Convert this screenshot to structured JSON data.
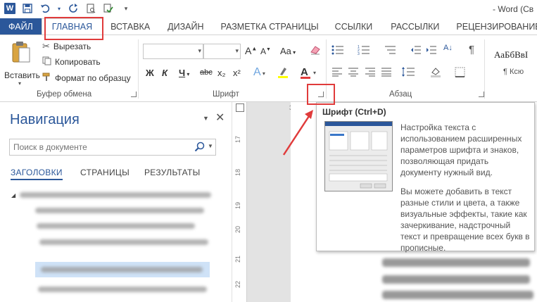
{
  "app": {
    "word_icon_letter": "W",
    "window_title": "- Word (Св"
  },
  "ribbon_tabs": [
    {
      "label": "ФАЙЛ"
    },
    {
      "label": "ГЛАВНАЯ"
    },
    {
      "label": "ВСТАВКА"
    },
    {
      "label": "ДИЗАЙН"
    },
    {
      "label": "РАЗМЕТКА СТРАНИЦЫ"
    },
    {
      "label": "ССЫЛКИ"
    },
    {
      "label": "РАССЫЛКИ"
    },
    {
      "label": "РЕЦЕНЗИРОВАНИЕ"
    }
  ],
  "clipboard": {
    "paste_label": "Вставить",
    "cut_label": "Вырезать",
    "copy_label": "Копировать",
    "format_painter_label": "Формат по образцу",
    "group_label": "Буфер обмена"
  },
  "font": {
    "group_label": "Шрифт",
    "font_name_value": "",
    "font_size_value": "",
    "grow_label": "A",
    "shrink_label": "A",
    "case_label": "Aa",
    "bold_label": "Ж",
    "italic_label": "К",
    "underline_label": "Ч",
    "strike_label": "abc",
    "subscript_label": "x₂",
    "superscript_label": "x²",
    "color_label": "A"
  },
  "paragraph": {
    "group_label": "Абзац",
    "show_marks_label": "¶"
  },
  "styles": {
    "sample": "АаБбВвІ",
    "name": "¶ Ксю"
  },
  "navigation": {
    "title": "Навигация",
    "search_placeholder": "Поиск в документе",
    "tabs": [
      {
        "label": "ЗАГОЛОВКИ"
      },
      {
        "label": "СТРАНИЦЫ"
      },
      {
        "label": "РЕЗУЛЬТАТЫ"
      }
    ]
  },
  "ruler": {
    "h_marker": "3",
    "v_marks": [
      "17",
      "18",
      "19",
      "20",
      "21",
      "22"
    ]
  },
  "tooltip": {
    "title": "Шрифт (Ctrl+D)",
    "text1": "Настройка текста с использованием расширенных параметров шрифта и знаков, позволяющая придать документу нужный вид.",
    "text2": "Вы можете добавить в текст разные стили и цвета, а также визуальные эффекты, такие как зачеркивание, надстрочный текст и превращение всех букв в прописные."
  },
  "colors": {
    "word_blue": "#2b579a",
    "highlight_red": "#e03b3b",
    "nav_selection": "#cfe2f7"
  }
}
